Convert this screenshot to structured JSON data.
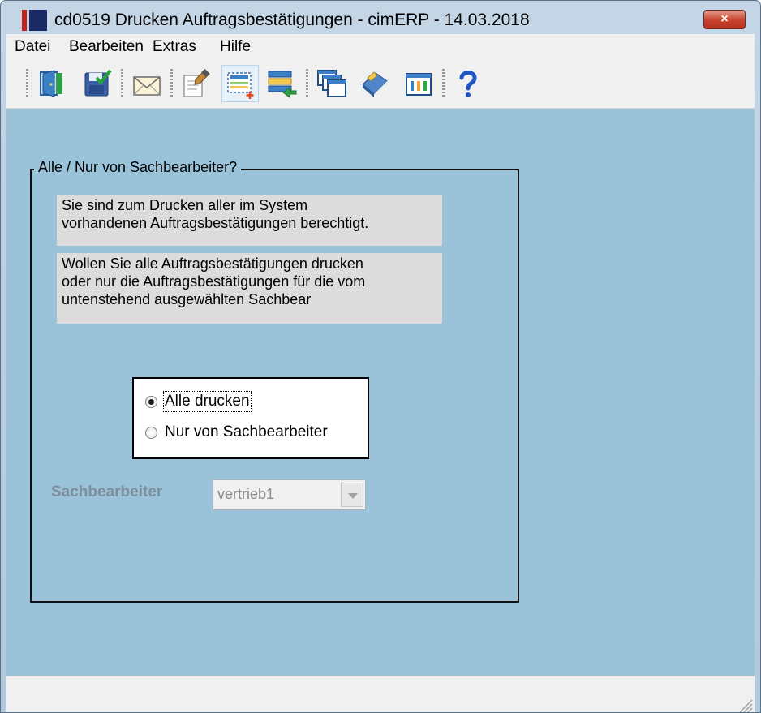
{
  "window": {
    "title": "cd0519 Drucken Auftragsbestätigungen - cimERP - 14.03.2018",
    "close_label": "×"
  },
  "menu": {
    "items": [
      "Datei",
      "Bearbeiten",
      "Extras",
      "Hilfe"
    ]
  },
  "toolbar": {
    "icons": [
      "exit-door-icon",
      "save-check-icon",
      "email-envelope-icon",
      "edit-document-icon",
      "new-record-icon",
      "list-transfer-icon",
      "copy-windows-icon",
      "book-icon",
      "grid-table-icon",
      "help-question-icon"
    ]
  },
  "group": {
    "legend": "Alle / Nur von Sachbearbeiter?",
    "message1": [
      "Sie sind zum Drucken aller im System",
      "vorhandenen Auftragsbestätigungen berechtigt."
    ],
    "message2": [
      "Wollen Sie alle Auftragsbestätigungen drucken",
      "oder nur die Auftragsbestätigungen für die vom",
      "untenstehend ausgewählten Sachbear"
    ],
    "options": [
      "Alle drucken",
      "Nur von Sachbearbeiter"
    ],
    "selected_option": "Alle drucken"
  },
  "sachbearbeiter": {
    "label": "Sachbearbeiter",
    "value": "vertrieb1"
  },
  "colors": {
    "background": "#9ac2d9",
    "title_close": "#c8432f"
  }
}
